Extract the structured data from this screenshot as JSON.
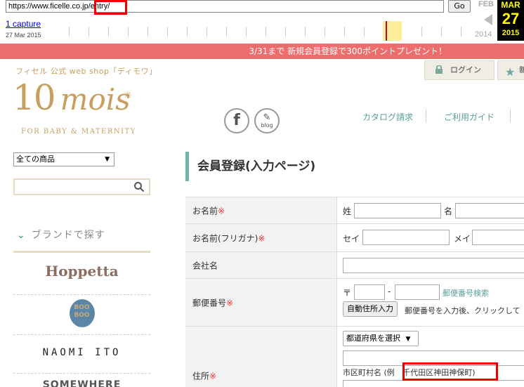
{
  "wayback": {
    "url": "https://www.ficelle.co.jp/entry/",
    "go_label": "Go",
    "captures_link": "1 capture",
    "capture_date": "27 Mar 2015",
    "prev_month": "FEB",
    "prev_year": "2014",
    "cur_month": "MAR",
    "cur_day": "27",
    "cur_year": "2015"
  },
  "promo": {
    "text": "3/31まで 新規会員登録で300ポイントプレゼント！"
  },
  "header": {
    "tagline": "フィセル 公式 web shop「ディモワ」",
    "logo_main": "10",
    "logo_script": "mois",
    "logo_sub": "FOR BABY & MATERNITY",
    "login_label": "ログイン",
    "new_label": "新",
    "facebook_glyph": "f",
    "blog_label": "blog",
    "nav": [
      "カタログ請求",
      "ご利用ガイド"
    ]
  },
  "sidebar": {
    "category_value": "全ての商品",
    "search_placeholder": "",
    "brand_heading": "ブランドで探す",
    "brands": [
      "Hoppetta",
      "BOO BOO",
      "NAOMI ITO",
      "SOMEWHERE"
    ]
  },
  "main": {
    "title": "会員登録(入力ページ)",
    "required_mark": "※",
    "fields": {
      "name": {
        "label": "お名前",
        "sei": "姓",
        "mei": "名"
      },
      "kana": {
        "label": "お名前(フリガナ)",
        "sei": "セイ",
        "mei": "メイ"
      },
      "company": {
        "label": "会社名"
      },
      "postal": {
        "label": "郵便番号",
        "mark": "〒",
        "dash": "-",
        "search_link": "郵便番号検索",
        "auto_button": "自動住所入力",
        "hint": "郵便番号を入力後、クリックして"
      },
      "address": {
        "label": "住所",
        "pref_select": "都道府県を選択",
        "city_hint_prefix": "市区町村名 (例",
        "city_hint_example": "千代田区神田神保町)"
      }
    }
  }
}
